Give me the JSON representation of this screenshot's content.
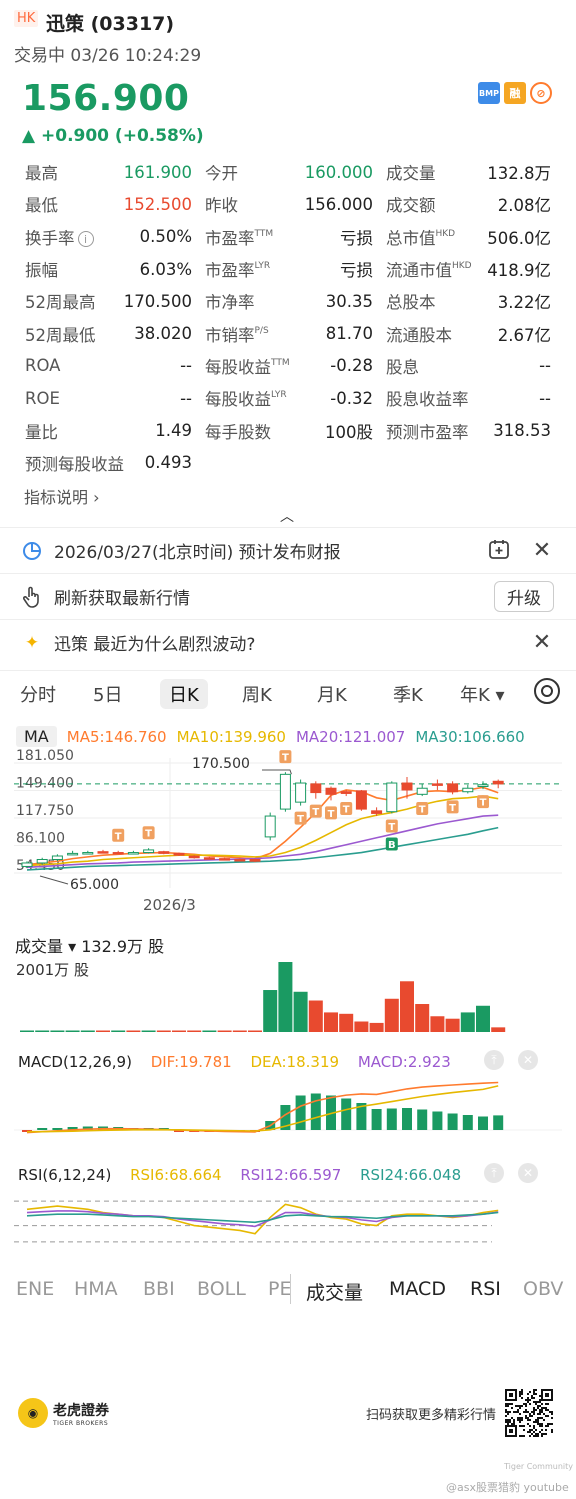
{
  "header": {
    "market_badge": "HK",
    "stock_name": "迅策 (03317)",
    "trade_status": "交易中 03/26 10:24:29",
    "price": "156.900",
    "change": "▲ +0.900 (+0.58%)",
    "badges": [
      "BMP",
      "融",
      "⊘"
    ]
  },
  "quote": {
    "rows": [
      [
        {
          "l": "最高",
          "v": "161.900",
          "c": "green"
        },
        {
          "l": "今开",
          "v": "160.000",
          "c": "green"
        },
        {
          "l": "成交量",
          "v": "132.8万"
        }
      ],
      [
        {
          "l": "最低",
          "v": "152.500",
          "c": "red"
        },
        {
          "l": "昨收",
          "v": "156.000"
        },
        {
          "l": "成交额",
          "v": "2.08亿"
        }
      ],
      [
        {
          "l": "换手率",
          "v": "0.50%",
          "info": true
        },
        {
          "l": "市盈率",
          "sup": "TTM",
          "v": "亏损"
        },
        {
          "l": "总市值",
          "sup": "HKD",
          "v": "506.0亿"
        }
      ],
      [
        {
          "l": "振幅",
          "v": "6.03%"
        },
        {
          "l": "市盈率",
          "sup": "LYR",
          "v": "亏损"
        },
        {
          "l": "流通市值",
          "sup": "HKD",
          "v": "418.9亿"
        }
      ],
      [
        {
          "l": "52周最高",
          "v": "170.500"
        },
        {
          "l": "市净率",
          "v": "30.35"
        },
        {
          "l": "总股本",
          "v": "3.22亿"
        }
      ],
      [
        {
          "l": "52周最低",
          "v": "38.020"
        },
        {
          "l": "市销率",
          "sup": "P/S",
          "v": "81.70"
        },
        {
          "l": "流通股本",
          "v": "2.67亿"
        }
      ],
      [
        {
          "l": "ROA",
          "v": "--"
        },
        {
          "l": "每股收益",
          "sup": "TTM",
          "v": "-0.28"
        },
        {
          "l": "股息",
          "v": "--"
        }
      ],
      [
        {
          "l": "ROE",
          "v": "--"
        },
        {
          "l": "每股收益",
          "sup": "LYR",
          "v": "-0.32"
        },
        {
          "l": "股息收益率",
          "v": "--"
        }
      ],
      [
        {
          "l": "量比",
          "v": "1.49"
        },
        {
          "l": "每手股数",
          "v": "100股"
        },
        {
          "l": "预测市盈率",
          "v": "318.53"
        }
      ],
      [
        {
          "l": "预测每股收益",
          "v": "0.493"
        }
      ]
    ],
    "indicator_link": "指标说明 ›"
  },
  "notices": {
    "earnings": "2026/03/27(北京时间) 预计发布财报",
    "refresh": "刷新获取最新行情",
    "upgrade": "升级",
    "ai_question": "迅策 最近为什么剧烈波动?"
  },
  "period_tabs": [
    "分时",
    "5日",
    "日K",
    "周K",
    "月K",
    "季K",
    "年K ▾"
  ],
  "ma_legend": {
    "label": "MA",
    "ma5": "MA5:146.760",
    "ma10": "MA10:139.960",
    "ma20": "MA20:121.007",
    "ma30": "MA30:106.660"
  },
  "kline_axis": {
    "y_labels": [
      "181.050",
      "149.400",
      "117.750",
      "86.100",
      "54.450"
    ],
    "high_label": "170.500",
    "low_label": "65.000",
    "date_label": "2026/3"
  },
  "volume": {
    "title": "成交量 ▾  132.9万 股",
    "max_label": "2001万 股"
  },
  "macd_legend": {
    "label": "MACD(12,26,9)",
    "dif": "DIF:19.781",
    "dea": "DEA:18.319",
    "macd": "MACD:2.923"
  },
  "rsi_legend": {
    "label": "RSI(6,12,24)",
    "rsi6": "RSI6:68.664",
    "rsi12": "RSI12:66.597",
    "rsi24": "RSI24:66.048"
  },
  "indicator_tabs": [
    "ENE",
    "HMA",
    "BBI",
    "BOLL",
    "PE",
    "成交量",
    "MACD",
    "RSI",
    "OBV"
  ],
  "footer": {
    "logo_cn": "老虎證券",
    "logo_en": "TIGER BROKERS",
    "scan_text": "扫码获取更多精彩行情",
    "watermark1": "Tiger Community",
    "watermark2": "@asx股票猎豹 youtube"
  },
  "colors": {
    "up_red": "#e84a2f",
    "down_green": "#1a9a62",
    "ma5": "#ff7b2e",
    "ma10": "#e6b800",
    "ma20": "#9b59d0",
    "ma30": "#2a9d8f"
  },
  "chart_data": [
    {
      "type": "candlestick",
      "title": "日K",
      "ylim": [
        54.45,
        181.05
      ],
      "x_label_ticks": [
        "2026/3"
      ],
      "candles": [
        {
          "o": 62,
          "c": 66,
          "h": 68,
          "l": 60
        },
        {
          "o": 66,
          "c": 70,
          "h": 72,
          "l": 64
        },
        {
          "o": 70,
          "c": 74,
          "h": 76,
          "l": 68
        },
        {
          "o": 76,
          "c": 77,
          "h": 80,
          "l": 75
        },
        {
          "o": 77,
          "c": 78,
          "h": 80,
          "l": 76
        },
        {
          "o": 79,
          "c": 78,
          "h": 81,
          "l": 77
        },
        {
          "o": 78,
          "c": 77,
          "h": 80,
          "l": 76
        },
        {
          "o": 77,
          "c": 78,
          "h": 80,
          "l": 76
        },
        {
          "o": 78,
          "c": 81,
          "h": 83,
          "l": 77
        },
        {
          "o": 79,
          "c": 77,
          "h": 80,
          "l": 76
        },
        {
          "o": 77,
          "c": 75,
          "h": 78,
          "l": 74
        },
        {
          "o": 74,
          "c": 72,
          "h": 75,
          "l": 71
        },
        {
          "o": 72,
          "c": 71,
          "h": 73,
          "l": 70
        },
        {
          "o": 71,
          "c": 70,
          "h": 72,
          "l": 69
        },
        {
          "o": 70,
          "c": 69,
          "h": 71,
          "l": 68
        },
        {
          "o": 70,
          "c": 68,
          "h": 71,
          "l": 67
        },
        {
          "o": 96,
          "c": 120,
          "h": 124,
          "l": 92
        },
        {
          "o": 128,
          "c": 168,
          "h": 170.5,
          "l": 125
        },
        {
          "o": 136,
          "c": 158,
          "h": 162,
          "l": 132
        },
        {
          "o": 157,
          "c": 147,
          "h": 160,
          "l": 140
        },
        {
          "o": 152,
          "c": 145,
          "h": 154,
          "l": 138
        },
        {
          "o": 148,
          "c": 146,
          "h": 150,
          "l": 143
        },
        {
          "o": 149,
          "c": 128,
          "h": 150,
          "l": 126
        },
        {
          "o": 126,
          "c": 123,
          "h": 130,
          "l": 120
        },
        {
          "o": 125,
          "c": 158,
          "h": 160,
          "l": 123
        },
        {
          "o": 158,
          "c": 150,
          "h": 165,
          "l": 140
        },
        {
          "o": 145,
          "c": 152,
          "h": 157,
          "l": 143
        },
        {
          "o": 157,
          "c": 156,
          "h": 162,
          "l": 150
        },
        {
          "o": 157,
          "c": 148,
          "h": 160,
          "l": 145
        },
        {
          "o": 148,
          "c": 152,
          "h": 156,
          "l": 146
        },
        {
          "o": 154,
          "c": 156,
          "h": 160,
          "l": 151
        },
        {
          "o": 160,
          "c": 157,
          "h": 162,
          "l": 152
        }
      ],
      "series": [
        {
          "name": "MA5",
          "values": [
            64,
            66,
            68,
            71,
            73,
            75,
            76,
            77,
            77.5,
            78,
            77,
            76,
            74,
            73,
            72,
            71,
            77,
            91,
            107,
            124,
            144,
            150,
            148,
            141,
            138,
            143,
            148,
            149,
            148,
            150,
            153,
            146.76
          ]
        },
        {
          "name": "MA10",
          "values": [
            63,
            64,
            65,
            67,
            68,
            70,
            71,
            72,
            73,
            74,
            75,
            75,
            75,
            74.5,
            74,
            73,
            74,
            78,
            84,
            92,
            101,
            110,
            117,
            121,
            124,
            128,
            133,
            137,
            140,
            141,
            143,
            139.96
          ]
        },
        {
          "name": "MA20",
          "values": [
            61,
            62,
            63,
            64,
            65,
            65.5,
            66,
            67,
            67.5,
            68,
            68.5,
            69,
            69.5,
            70,
            70.5,
            71,
            72,
            74,
            76,
            79,
            83,
            87,
            91,
            95,
            99,
            103,
            107,
            111,
            114,
            117,
            120,
            121.007
          ]
        },
        {
          "name": "MA30",
          "values": [
            58,
            59,
            60,
            61,
            62,
            62.5,
            63,
            63.5,
            64,
            64.5,
            65,
            65.5,
            66,
            66.5,
            67,
            67.5,
            68,
            69,
            70,
            72,
            74,
            76,
            78,
            81,
            84,
            87,
            90,
            93,
            96,
            99,
            103,
            106.66
          ]
        }
      ],
      "annotations": {
        "high": "170.500",
        "low": "65.000"
      },
      "event_markers": [
        "T",
        "T",
        "T",
        "T",
        "T",
        "T",
        "T",
        "T",
        "T",
        "T",
        "T",
        "B"
      ]
    },
    {
      "type": "bar",
      "title": "成交量",
      "unit": "万股",
      "ylim": [
        0,
        2001
      ],
      "values": [
        20,
        25,
        30,
        35,
        35,
        25,
        15,
        10,
        18,
        15,
        12,
        10,
        10,
        8,
        10,
        12,
        1200,
        2001,
        1150,
        900,
        560,
        520,
        300,
        260,
        950,
        1450,
        800,
        450,
        380,
        560,
        750,
        132.9
      ],
      "colors": [
        "green",
        "green",
        "green",
        "green",
        "green",
        "red",
        "green",
        "red",
        "green",
        "red",
        "red",
        "red",
        "green",
        "red",
        "red",
        "red",
        "green",
        "green",
        "green",
        "red",
        "red",
        "red",
        "red",
        "red",
        "red",
        "red",
        "red",
        "red",
        "red",
        "green",
        "green",
        "red"
      ]
    },
    {
      "type": "line",
      "title": "MACD(12,26,9)",
      "series": [
        {
          "name": "DIF",
          "values": [
            -2,
            -1.6,
            -1.2,
            -0.8,
            -0.5,
            -0.3,
            -0.3,
            -0.4,
            -0.5,
            -0.7,
            -0.9,
            -1.1,
            -1.3,
            -1.5,
            -1.6,
            -1.7,
            1.0,
            5.8,
            9.5,
            11.8,
            13.2,
            14.3,
            14.8,
            14.6,
            15.8,
            17.0,
            17.8,
            18.3,
            18.7,
            19.1,
            19.5,
            19.781
          ]
        },
        {
          "name": "DEA",
          "values": [
            -1.6,
            -1.6,
            -1.5,
            -1.4,
            -1.2,
            -1.0,
            -0.9,
            -0.8,
            -0.8,
            -0.8,
            -0.8,
            -0.9,
            -1.0,
            -1.1,
            -1.2,
            -1.3,
            -0.8,
            0.8,
            2.6,
            4.5,
            6.3,
            8.0,
            9.4,
            10.4,
            11.5,
            12.6,
            13.7,
            14.6,
            15.4,
            16.1,
            16.8,
            18.319
          ]
        },
        {
          "name": "MACD",
          "values": [
            -0.4,
            0.0,
            0.3,
            0.6,
            0.7,
            0.7,
            0.6,
            0.4,
            0.3,
            0.1,
            -0.1,
            -0.2,
            -0.3,
            -0.4,
            -0.4,
            -0.4,
            1.8,
            5.0,
            6.9,
            7.3,
            6.9,
            6.3,
            5.4,
            4.2,
            4.3,
            4.4,
            4.1,
            3.7,
            3.3,
            3.0,
            2.7,
            2.923
          ]
        }
      ]
    },
    {
      "type": "line",
      "title": "RSI(6,12,24)",
      "ylim": [
        0,
        100
      ],
      "series": [
        {
          "name": "RSI6",
          "values": [
            70,
            72,
            74,
            72,
            70,
            66,
            64,
            62,
            62,
            60,
            55,
            50,
            48,
            46,
            44,
            40,
            60,
            76,
            72,
            64,
            60,
            58,
            52,
            50,
            62,
            64,
            64,
            62,
            60,
            62,
            66,
            68.664
          ]
        },
        {
          "name": "RSI12",
          "values": [
            66,
            67,
            68,
            68,
            67,
            65,
            64,
            62,
            62,
            61,
            58,
            56,
            54,
            52,
            51,
            49,
            57,
            66,
            66,
            63,
            61,
            60,
            57,
            55,
            60,
            62,
            62,
            62,
            61,
            62,
            64,
            66.597
          ]
        },
        {
          "name": "RSI24",
          "values": [
            62,
            63,
            64,
            64,
            64,
            63,
            62,
            61,
            61,
            60,
            59,
            58,
            57,
            56,
            55,
            54,
            57,
            62,
            63,
            62,
            61,
            61,
            60,
            59,
            61,
            62,
            62,
            62,
            62,
            63,
            64,
            66.048
          ]
        }
      ]
    }
  ]
}
